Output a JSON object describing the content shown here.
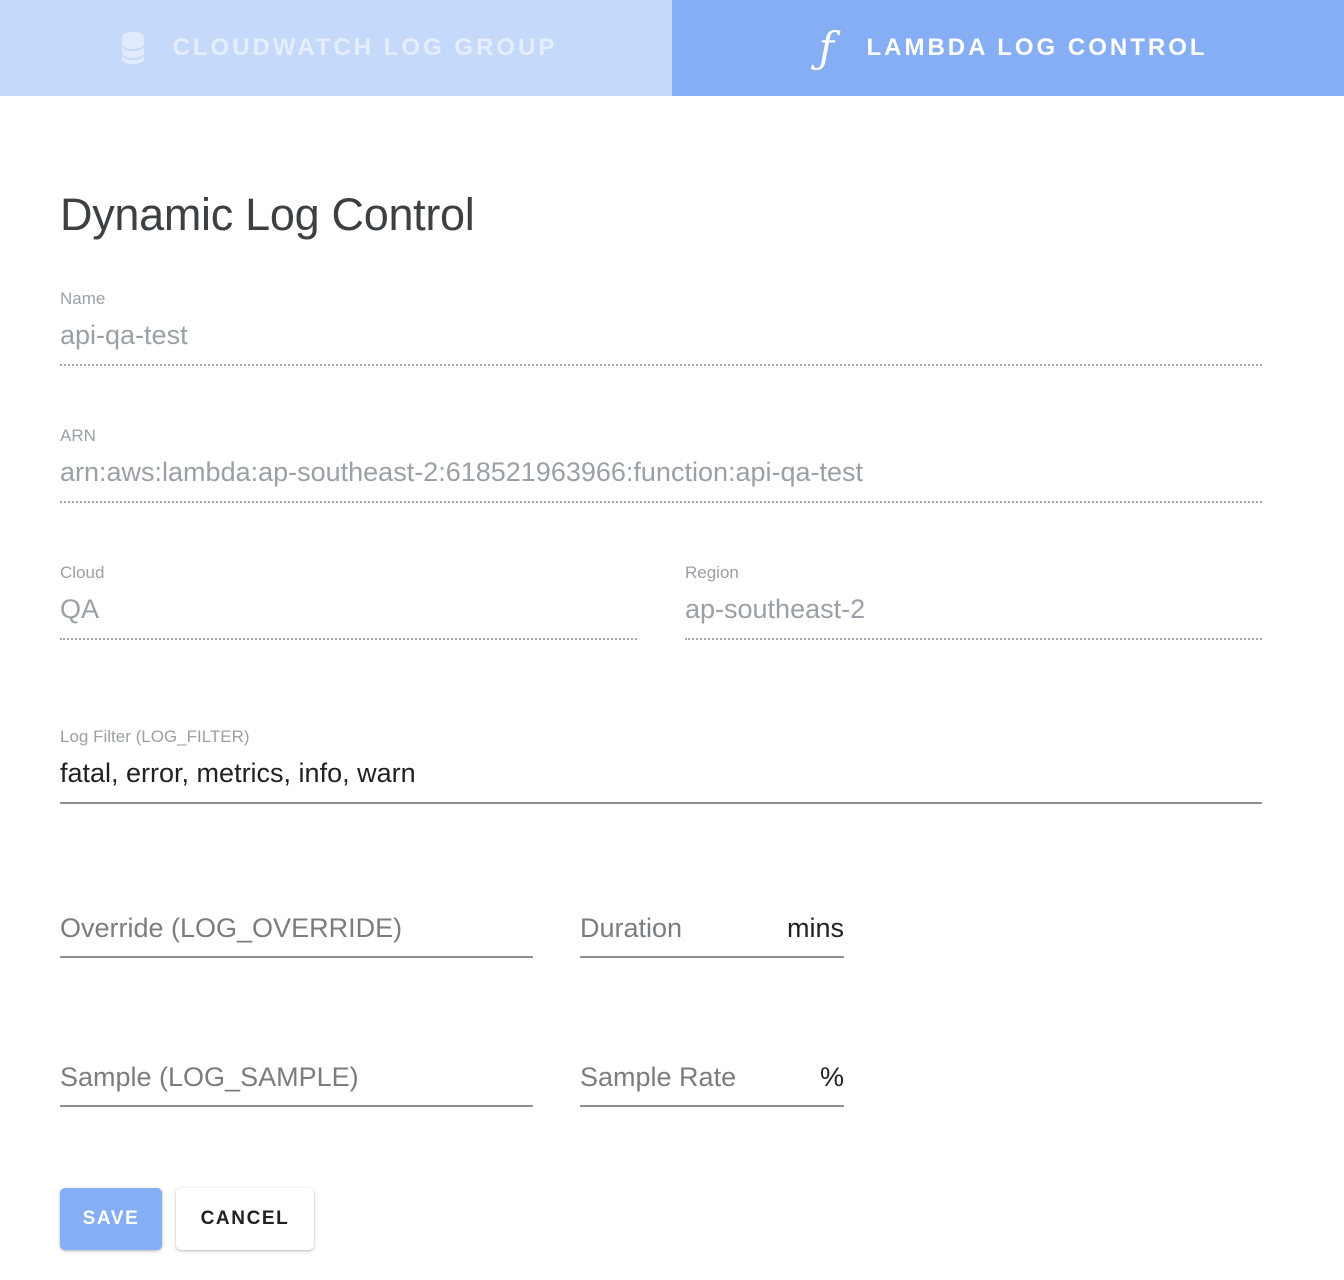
{
  "tabs": [
    {
      "id": "cloudwatch-log-group",
      "label": "CloudWatch Log Group",
      "icon": "database-icon",
      "active": false,
      "bg": "#c5d9fb",
      "text_color": "#e6eefd"
    },
    {
      "id": "lambda-log-control",
      "label": "Lambda Log Control",
      "icon": "lambda-function-icon",
      "icon_glyph": "ƒ",
      "active": true,
      "bg": "#86aef5",
      "text_color": "#ffffff"
    }
  ],
  "page": {
    "title": "Dynamic Log Control"
  },
  "form": {
    "name": {
      "label": "Name",
      "value": "api-qa-test",
      "disabled": true
    },
    "arn": {
      "label": "ARN",
      "value": "arn:aws:lambda:ap-southeast-2:618521963966:function:api-qa-test",
      "disabled": true
    },
    "cloud": {
      "label": "Cloud",
      "value": "QA",
      "disabled": true
    },
    "region": {
      "label": "Region",
      "value": "ap-southeast-2",
      "disabled": true
    },
    "log_filter": {
      "label": "Log Filter (LOG_FILTER)",
      "value": "fatal, error, metrics, info, warn",
      "disabled": false
    },
    "override": {
      "placeholder": "Override (LOG_OVERRIDE)",
      "value": ""
    },
    "duration": {
      "placeholder": "Duration",
      "value": "",
      "suffix": "mins"
    },
    "sample": {
      "placeholder": "Sample (LOG_SAMPLE)",
      "value": ""
    },
    "sample_rate": {
      "placeholder": "Sample Rate",
      "value": "",
      "suffix": "%"
    }
  },
  "actions": {
    "save_label": "Save",
    "cancel_label": "Cancel",
    "save_color": "#86aef5"
  }
}
